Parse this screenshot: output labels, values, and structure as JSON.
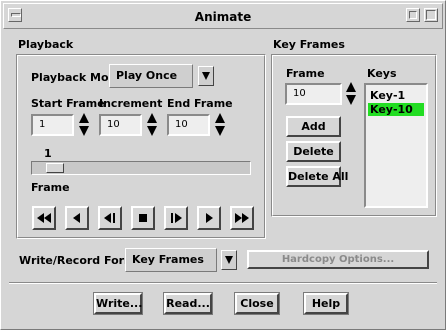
{
  "window": {
    "title": "Animate"
  },
  "playback": {
    "section_label": "Playback",
    "mode_label": "Playback Mode",
    "mode_value": "Play Once",
    "start_frame_label": "Start Frame",
    "start_frame_value": "1",
    "increment_label": "Increment",
    "increment_value": "10",
    "end_frame_label": "End Frame",
    "end_frame_value": "10",
    "current_frame": "1",
    "frame_label": "Frame",
    "controls": [
      "rewind",
      "step-back",
      "play-reverse",
      "stop",
      "play",
      "step-forward",
      "fast-forward"
    ]
  },
  "keyframes": {
    "section_label": "Key Frames",
    "frame_label": "Frame",
    "frame_value": "10",
    "keys_label": "Keys",
    "keys": [
      "Key-1",
      "Key-10"
    ],
    "selected_key": "Key-10",
    "add_label": "Add",
    "delete_label": "Delete",
    "delete_all_label": "Delete All"
  },
  "record": {
    "format_label": "Write/Record Format",
    "format_value": "Key Frames",
    "hardcopy_label": "Hardcopy Options..."
  },
  "footer": {
    "write_label": "Write...",
    "read_label": "Read...",
    "close_label": "Close",
    "help_label": "Help"
  },
  "colors": {
    "background": "#d6d6d6",
    "field": "#eeeeee",
    "selection": "#22dd22"
  }
}
